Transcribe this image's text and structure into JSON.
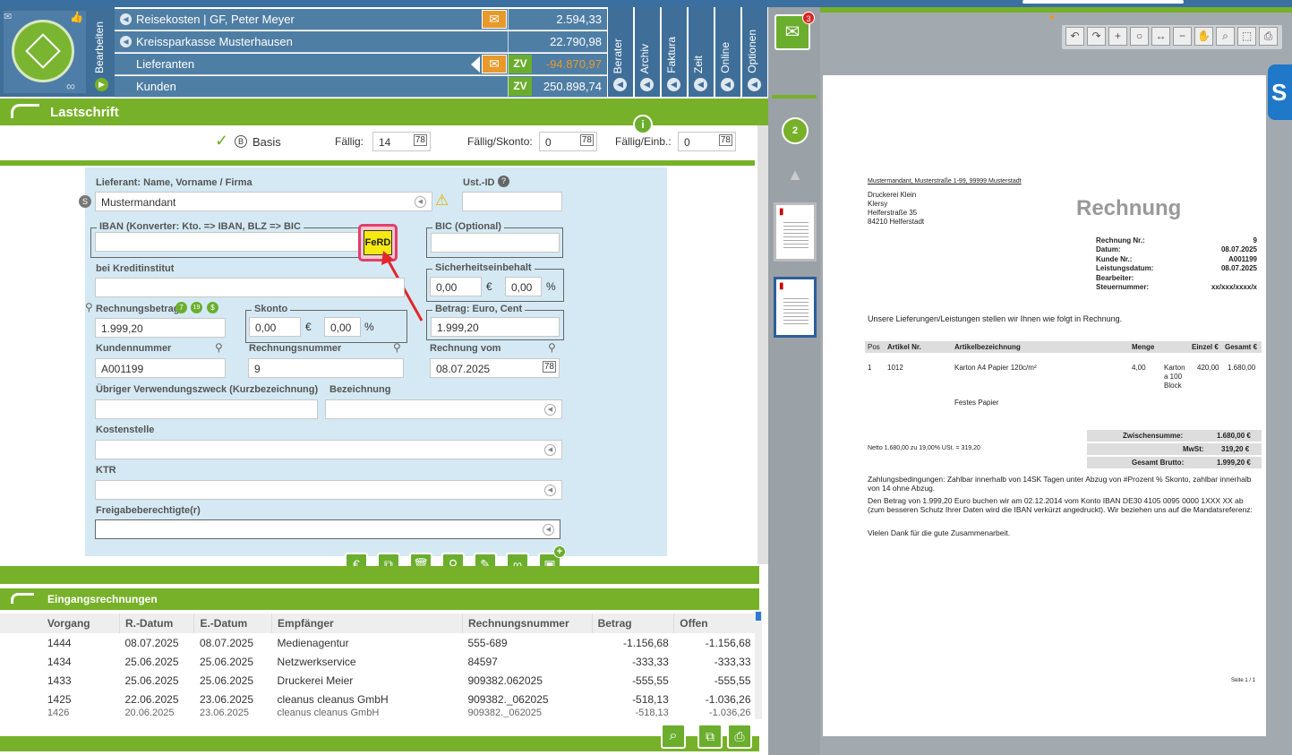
{
  "nav": {
    "tabs": [
      "Bearbeiten",
      "Berater",
      "Archiv",
      "Faktura",
      "Zeit",
      "Online",
      "Optionen"
    ]
  },
  "accounts": [
    {
      "name": "Reisekosten | GF, Peter Meyer",
      "amount": "2.594,33",
      "has_envelope": true,
      "zv": false
    },
    {
      "name": "Kreissparkasse Musterhausen",
      "amount": "22.790,98",
      "has_envelope": false,
      "zv": false
    },
    {
      "name": "Lieferanten",
      "amount": "-94.870,97",
      "has_envelope": true,
      "zv": true,
      "amount_color": "#e79a2b"
    },
    {
      "name": "Kunden",
      "amount": "250.898,74",
      "has_envelope": false,
      "zv": true
    }
  ],
  "inbox": {
    "badge": "3"
  },
  "form": {
    "title": "Lastschrift",
    "basis_label": "Basis",
    "basis_key": "B",
    "faellig_label": "Fällig:",
    "faellig_value": "14",
    "faellig_skonto_label": "Fällig/Skonto:",
    "faellig_skonto_value": "0",
    "faellig_einb_label": "Fällig/Einb.:",
    "faellig_einb_value": "0",
    "lieferant_label": "Lieferant: Name, Vorname / Firma",
    "lieferant_value": "Mustermandant",
    "ustid_label": "Ust.-ID",
    "iban_label": "IBAN (Konverter: Kto. => IBAN, BLZ => BIC",
    "ferd_label": "FeRD",
    "bic_label": "BIC (Optional)",
    "kredit_label": "bei Kreditinstitut",
    "sicherheit_label": "Sicherheitseinbehalt",
    "sicherheit_eur": "0,00",
    "sicherheit_pct": "0,00",
    "rbetrag_label": "Rechnungsbetrag",
    "rbetrag_value": "1.999,20",
    "badge_7": "7",
    "badge_19": "19",
    "badge_s": "$",
    "skonto_label": "Skonto",
    "skonto_eur": "0,00",
    "skonto_pct": "0,00",
    "betrag_label": "Betrag: Euro, Cent",
    "betrag_value": "1.999,20",
    "euro_sym": "€",
    "pct_sym": "%",
    "kunden_label": "Kundennummer",
    "kunden_value": "A001199",
    "rnr_label": "Rechnungsnummer",
    "rnr_value": "9",
    "rvom_label": "Rechnung vom",
    "rvom_value": "08.07.2025",
    "vzweck_label": "Übriger Verwendungszweck (Kurzbezeichnung)",
    "bez_label": "Bezeichnung",
    "kst_label": "Kostenstelle",
    "ktr_label": "KTR",
    "frei_label": "Freigabeberechtigte(r)"
  },
  "list": {
    "title": "Eingangsrechnungen",
    "columns": [
      "Vorgang",
      "R.-Datum",
      "E.-Datum",
      "Empfänger",
      "Rechnungsnummer",
      "Betrag",
      "Offen"
    ],
    "rows": [
      [
        "1444",
        "08.07.2025",
        "08.07.2025",
        "Medienagentur",
        "555-689",
        "-1.156,68",
        "-1.156,68"
      ],
      [
        "1434",
        "25.06.2025",
        "25.06.2025",
        "Netzwerkservice",
        "84597",
        "-333,33",
        "-333,33"
      ],
      [
        "1433",
        "25.06.2025",
        "25.06.2025",
        "Druckerei Meier",
        "909382.062025",
        "-555,55",
        "-555,55"
      ],
      [
        "1425",
        "22.06.2025",
        "23.06.2025",
        "cleanus cleanus GmbH",
        "909382._062025",
        "-518,13",
        "-1.036,26"
      ],
      [
        "1426",
        "20.06.2025",
        "23.06.2025",
        "cleanus cleanus GmbH",
        "909382._062025",
        "-518,13",
        "-1.036,26"
      ]
    ]
  },
  "thumbs": {
    "count_badge": "2"
  },
  "invoice": {
    "sender_line": "Mustermandant, Musterstraße 1-99, 99999 Musterstadt",
    "recipient": [
      "Druckerei Klein",
      "Klersy",
      "Helferstraße 35",
      "84210 Helferstadt"
    ],
    "title": "Rechnung",
    "meta": [
      [
        "Rechnung Nr.:",
        "9"
      ],
      [
        "Datum:",
        "08.07.2025"
      ],
      [
        "Kunde Nr.:",
        "A001199"
      ],
      [
        "Leistungsdatum:",
        "08.07.2025"
      ],
      [
        "Bearbeiter:",
        ""
      ],
      [
        "Steuernummer:",
        "xx/xxx/xxxx/x"
      ]
    ],
    "intro": "Unsere Lieferungen/Leistungen stellen wir Ihnen wie folgt in Rechnung.",
    "table_head": [
      "Pos",
      "Artikel Nr.",
      "Artikelbezeichnung",
      "Menge",
      "",
      "Einzel €",
      "Gesamt €"
    ],
    "item": {
      "pos": "1",
      "art": "1012",
      "desc": "Karton A4 Papier 120c/m²",
      "menge": "4,00",
      "einheit": "Karton a 100 Block",
      "einzel": "420,00",
      "gesamt": "1.680,00",
      "note": "Festes Papier"
    },
    "zwischen_label": "Zwischensumme:",
    "zwischen_value": "1.680,00 €",
    "mwst_label": "MwSt:",
    "mwst_value": "319,20 €",
    "brutto_label": "Gesamt Brutto:",
    "brutto_value": "1.999,20 €",
    "netto_line": "Netto 1.680,00 zu 19,00% USt. = 319,20",
    "zahlung": "Zahlungsbedingungen: Zahlbar innerhalb von 14SK Tagen unter Abzug von #Prozent % Skonto, zahlbar innerhalb von 14 ohne Abzug.",
    "lastschrift_text": "Den Betrag von 1.999,20 Euro buchen wir am 02.12.2014 vom Konto IBAN DE30 4105 0095 0000 1XXX XX ab (zum besseren Schutz Ihrer Daten wird die IBAN verkürzt angedruckt). Wir beziehen uns auf die Mandatsreferenz:",
    "thanks": "Vielen Dank für die gute Zusammenarbeit.",
    "page": "Seite 1 / 1"
  },
  "colors": {
    "green": "#77b129",
    "blue": "#3f6f99",
    "panel": "#d4e9f3",
    "orange": "#e79a2b",
    "red": "#cc0000"
  }
}
